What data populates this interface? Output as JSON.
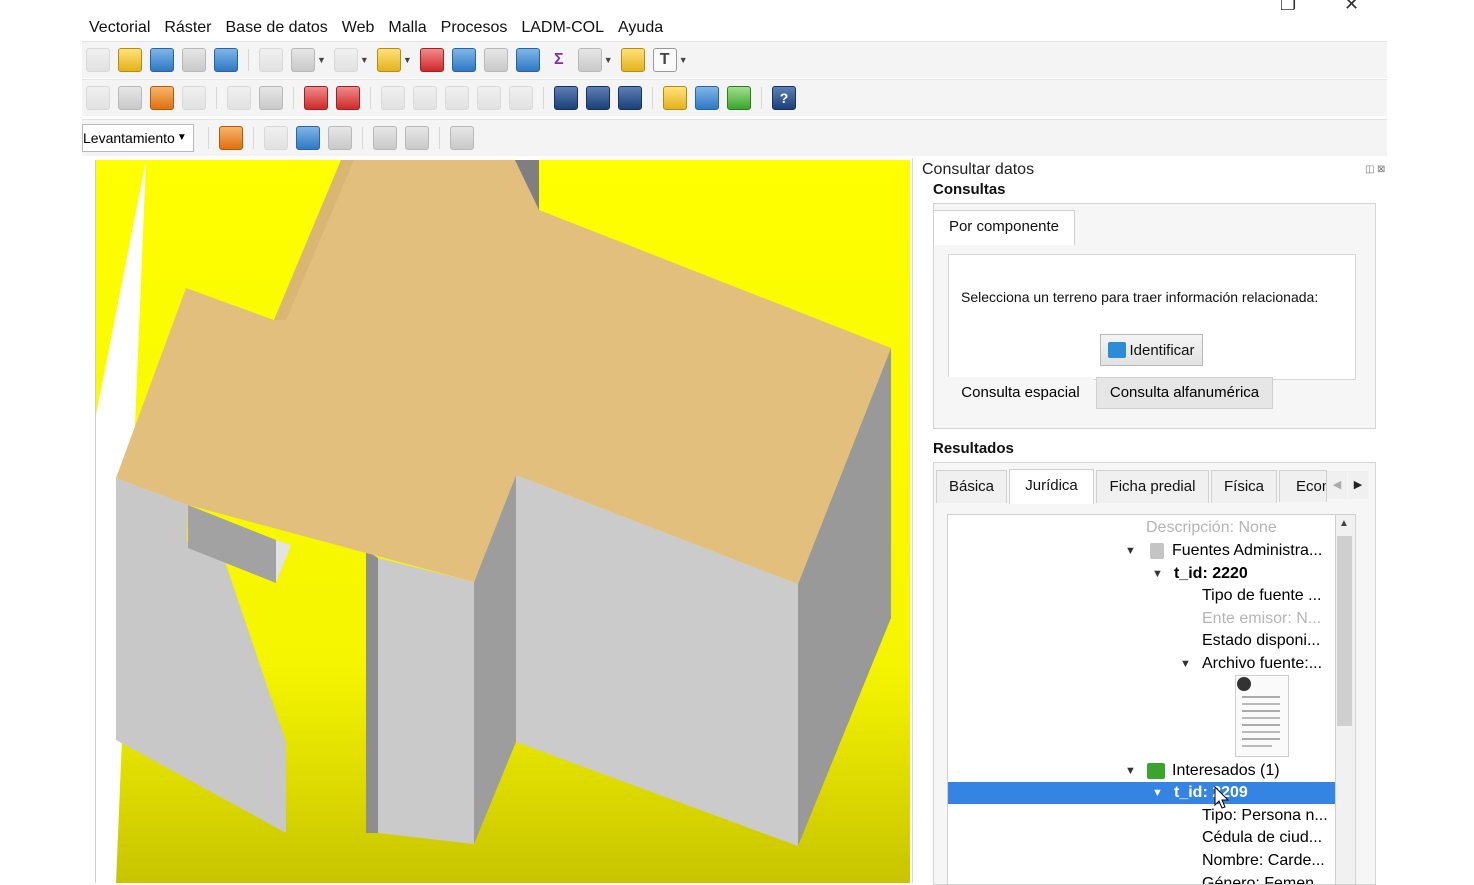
{
  "menubar": {
    "items": [
      {
        "label": "Vectorial"
      },
      {
        "label": "Ráster"
      },
      {
        "label": "Base de datos"
      },
      {
        "label": "Web"
      },
      {
        "label": "Malla"
      },
      {
        "label": "Procesos"
      },
      {
        "label": "LADM-COL"
      },
      {
        "label": "Ayuda"
      }
    ]
  },
  "toolbar3": {
    "combo_value": "Levantamiento"
  },
  "icons": {
    "help_glyph": "?",
    "sigma_glyph": "Σ",
    "text_glyph": "T"
  },
  "panel": {
    "title": "Consultar datos",
    "consultas_title": "Consultas",
    "tabs": [
      {
        "label": "Por componente"
      }
    ],
    "prompt": "Selecciona un terreno para traer información relacionada:",
    "identify_button": "Identificar",
    "subtabs": [
      {
        "label": "Consulta espacial"
      },
      {
        "label": "Consulta alfanumérica"
      }
    ],
    "results_title": "Resultados",
    "result_tabs": [
      {
        "label": "Básica"
      },
      {
        "label": "Jurídica"
      },
      {
        "label": "Ficha predial"
      },
      {
        "label": "Física"
      },
      {
        "label": "Econ"
      }
    ]
  },
  "tree": {
    "rows": [
      {
        "text": "Descripción: None"
      },
      {
        "text": "Fuentes Administra..."
      },
      {
        "text": "t_id: 2220"
      },
      {
        "text": "Tipo de fuente ..."
      },
      {
        "text": "Ente emisor: N..."
      },
      {
        "text": "Estado disponi..."
      },
      {
        "text": "Archivo fuente:..."
      },
      {
        "text": "Interesados (1)"
      },
      {
        "text": "t_id: 2209"
      },
      {
        "text": "Tipo: Persona n..."
      },
      {
        "text": "Cédula de ciud..."
      },
      {
        "text": "Nombre: Carde..."
      },
      {
        "text": "Género: Femen..."
      }
    ]
  },
  "colors": {
    "map_background": "#ffff00",
    "roof": "#e2bf7d",
    "wall_light": "#cfcfcf",
    "wall_dark": "#9b9b9b",
    "selection": "#3584e4"
  }
}
